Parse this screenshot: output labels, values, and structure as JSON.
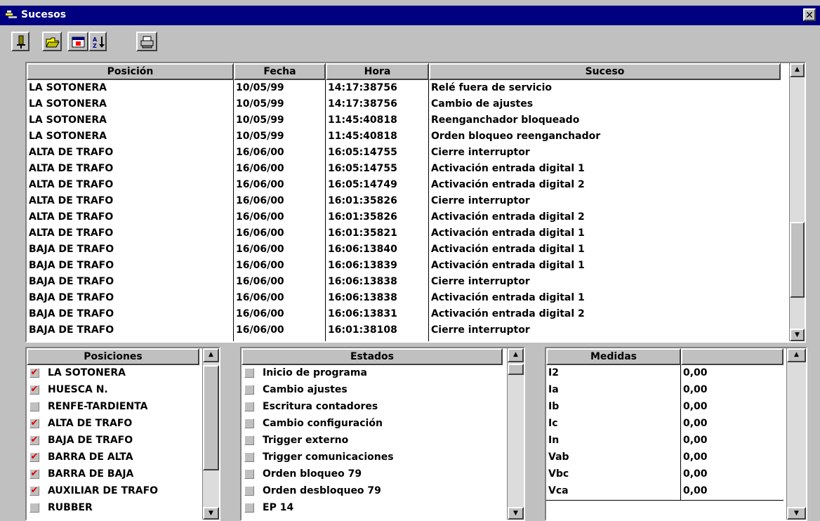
{
  "window": {
    "title": "Sucesos",
    "close_glyph": "✕"
  },
  "toolbar": [
    "exit-icon",
    "open-folder-icon",
    "calendar-icon",
    "sort-icon",
    "print-icon"
  ],
  "events": {
    "columns": [
      "Posición",
      "Fecha",
      "Hora",
      "Suceso"
    ],
    "rows": [
      [
        "LA SOTONERA",
        "10/05/99",
        "14:17:38756",
        "Relé fuera de servicio"
      ],
      [
        "LA SOTONERA",
        "10/05/99",
        "14:17:38756",
        "Cambio de ajustes"
      ],
      [
        "LA SOTONERA",
        "10/05/99",
        "11:45:40818",
        "Reenganchador bloqueado"
      ],
      [
        "LA SOTONERA",
        "10/05/99",
        "11:45:40818",
        "Orden bloqueo reenganchador"
      ],
      [
        "ALTA DE TRAFO",
        "16/06/00",
        "16:05:14755",
        "Cierre interruptor"
      ],
      [
        "ALTA DE TRAFO",
        "16/06/00",
        "16:05:14755",
        "Activación entrada digital 1"
      ],
      [
        "ALTA DE TRAFO",
        "16/06/00",
        "16:05:14749",
        "Activación entrada digital 2"
      ],
      [
        "ALTA DE TRAFO",
        "16/06/00",
        "16:01:35826",
        "Cierre interruptor"
      ],
      [
        "ALTA DE TRAFO",
        "16/06/00",
        "16:01:35826",
        "Activación entrada digital 2"
      ],
      [
        "ALTA DE TRAFO",
        "16/06/00",
        "16:01:35821",
        "Activación entrada digital 1"
      ],
      [
        "BAJA DE TRAFO",
        "16/06/00",
        "16:06:13840",
        "Activación entrada digital 1"
      ],
      [
        "BAJA DE TRAFO",
        "16/06/00",
        "16:06:13839",
        "Activación entrada digital 1"
      ],
      [
        "BAJA DE TRAFO",
        "16/06/00",
        "16:06:13838",
        "Cierre interruptor"
      ],
      [
        "BAJA DE TRAFO",
        "16/06/00",
        "16:06:13838",
        "Activación entrada digital 1"
      ],
      [
        "BAJA DE TRAFO",
        "16/06/00",
        "16:06:13831",
        "Activación entrada digital 2"
      ],
      [
        "BAJA DE TRAFO",
        "16/06/00",
        "16:01:38108",
        "Cierre interruptor"
      ]
    ]
  },
  "positions": {
    "header": "Posiciones",
    "items": [
      {
        "label": "LA SOTONERA",
        "checked": true
      },
      {
        "label": "HUESCA N.",
        "checked": true
      },
      {
        "label": "RENFE-TARDIENTA",
        "checked": false
      },
      {
        "label": "ALTA DE TRAFO",
        "checked": true
      },
      {
        "label": "BAJA DE TRAFO",
        "checked": true
      },
      {
        "label": "BARRA DE ALTA",
        "checked": true
      },
      {
        "label": "BARRA DE BAJA",
        "checked": true
      },
      {
        "label": "AUXILIAR DE TRAFO",
        "checked": true
      },
      {
        "label": "RUBBER",
        "checked": false
      }
    ]
  },
  "states": {
    "header": "Estados",
    "items": [
      {
        "label": "Inicio de programa",
        "checked": false
      },
      {
        "label": "Cambio ajustes",
        "checked": false
      },
      {
        "label": "Escritura contadores",
        "checked": false
      },
      {
        "label": "Cambio configuración",
        "checked": false
      },
      {
        "label": "Trigger externo",
        "checked": false
      },
      {
        "label": "Trigger comunicaciones",
        "checked": false
      },
      {
        "label": "Orden bloqueo 79",
        "checked": false
      },
      {
        "label": "Orden desbloqueo 79",
        "checked": false
      },
      {
        "label": "EP 14",
        "checked": false
      }
    ]
  },
  "measures": {
    "header": "Medidas",
    "header2": "",
    "rows": [
      [
        "I2",
        "0,00"
      ],
      [
        "Ia",
        "0,00"
      ],
      [
        "Ib",
        "0,00"
      ],
      [
        "Ic",
        "0,00"
      ],
      [
        "In",
        "0,00"
      ],
      [
        "Vab",
        "0,00"
      ],
      [
        "Vbc",
        "0,00"
      ],
      [
        "Vca",
        "0,00"
      ]
    ]
  }
}
